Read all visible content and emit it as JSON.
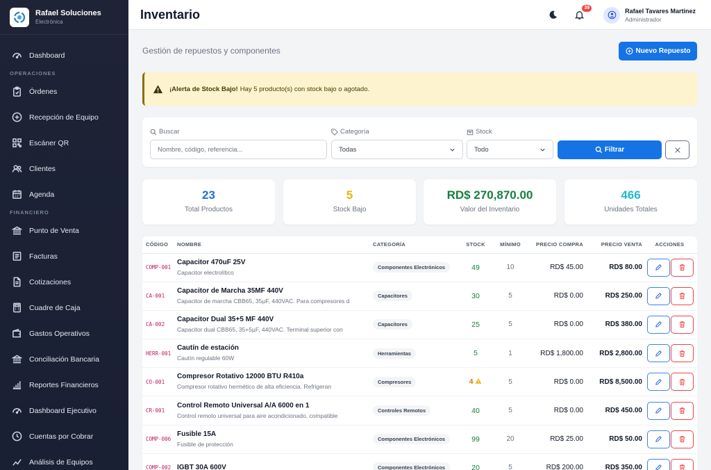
{
  "brand": {
    "name": "Rafael Soluciones",
    "sub": "Electrónica"
  },
  "sidebar": {
    "dashboard": "Dashboard",
    "section_ops": "OPERACIONES",
    "ops": [
      "Órdenes",
      "Recepción de Equipo",
      "Escáner QR",
      "Clientes",
      "Agenda"
    ],
    "section_fin": "FINANCIERO",
    "fin": [
      "Punto de Venta",
      "Facturas",
      "Cotizaciones",
      "Cuadre de Caja",
      "Gastos Operativos",
      "Conciliación Bancaria",
      "Reportes Financieros",
      "Dashboard Ejecutivo",
      "Cuentas por Cobrar",
      "Análisis de Equipos"
    ]
  },
  "header": {
    "title": "Inventario",
    "notif_count": "39",
    "user_name": "Rafael Tavares Martinez",
    "user_role": "Administrador"
  },
  "page": {
    "subtitle": "Gestión de repuestos y componentes",
    "new_button": "Nuevo Repuesto"
  },
  "alert": {
    "title": "¡Alerta de Stock Bajo!",
    "text": "Hay 5 producto(s) con stock bajo o agotado."
  },
  "filters": {
    "search_label": "Buscar",
    "search_placeholder": "Nombre, código, referencia...",
    "category_label": "Categoría",
    "category_value": "Todas",
    "stock_label": "Stock",
    "stock_value": "Todo",
    "filter_button": "Filtrar"
  },
  "stats": [
    {
      "value": "23",
      "label": "Total Productos",
      "color": "#1d6fd8"
    },
    {
      "value": "5",
      "label": "Stock Bajo",
      "color": "#eab308"
    },
    {
      "value": "RD$ 270,870.00",
      "label": "Valor del Inventario",
      "color": "#15803d"
    },
    {
      "value": "466",
      "label": "Unidades Totales",
      "color": "#22b8cf"
    }
  ],
  "table": {
    "headers": [
      "CÓDIGO",
      "NOMBRE",
      "CATEGORÍA",
      "STOCK",
      "MÍNIMO",
      "PRECIO COMPRA",
      "PRECIO VENTA",
      "ACCIONES"
    ],
    "rows": [
      {
        "code": "COMP-001",
        "name": "Capacitor 470uF 25V",
        "desc": "Capacitor electrolítico",
        "category": "Componentes Electrónicos",
        "stock": "49",
        "min": "10",
        "buy": "RD$ 45.00",
        "sell": "RD$ 80.00"
      },
      {
        "code": "CA-001",
        "name": "Capacitor de Marcha 35MF 440V",
        "desc": "Capacitor de marcha CBB65, 35µF, 440VAC. Para compresores d",
        "category": "Capacitores",
        "stock": "30",
        "min": "5",
        "buy": "RD$ 0.00",
        "sell": "RD$ 250.00"
      },
      {
        "code": "CA-002",
        "name": "Capacitor Dual 35+5 MF 440V",
        "desc": "Capacitor dual CBB65, 35+5µF, 440VAC. Terminal superior con",
        "category": "Capacitores",
        "stock": "25",
        "min": "5",
        "buy": "RD$ 0.00",
        "sell": "RD$ 380.00"
      },
      {
        "code": "HERR-001",
        "name": "Cautín de estación",
        "desc": "Cautín regulable 60W",
        "category": "Herramientas",
        "stock": "5",
        "min": "1",
        "buy": "RD$ 1,800.00",
        "sell": "RD$ 2,800.00"
      },
      {
        "code": "CO-001",
        "name": "Compresor Rotativo 12000 BTU R410a",
        "desc": "Compresor rotativo hermético de alta eficiencia. Refrigeran",
        "category": "Compresores",
        "stock": "4",
        "low": true,
        "min": "5",
        "buy": "RD$ 0.00",
        "sell": "RD$ 8,500.00"
      },
      {
        "code": "CR-001",
        "name": "Control Remoto Universal A/A 6000 en 1",
        "desc": "Control remoto universal para aire acondicionado, compatible",
        "category": "Controles Remotos",
        "stock": "40",
        "min": "5",
        "buy": "RD$ 0.00",
        "sell": "RD$ 450.00"
      },
      {
        "code": "COMP-006",
        "name": "Fusible 15A",
        "desc": "Fusible de protección",
        "category": "Componentes Electrónicos",
        "stock": "99",
        "min": "20",
        "buy": "RD$ 25.00",
        "sell": "RD$ 50.00"
      },
      {
        "code": "COMP-002",
        "name": "IGBT 30A 600V",
        "desc": "",
        "category": "Componentes Electrónicos",
        "stock": "20",
        "min": "5",
        "buy": "RD$ 200.00",
        "sell": "RD$ 350.00"
      }
    ]
  },
  "colors": {
    "primary": "#1573e6",
    "sidebar": "#1e2336",
    "alert_bg": "#fdf3cf",
    "danger": "#ef4444"
  }
}
